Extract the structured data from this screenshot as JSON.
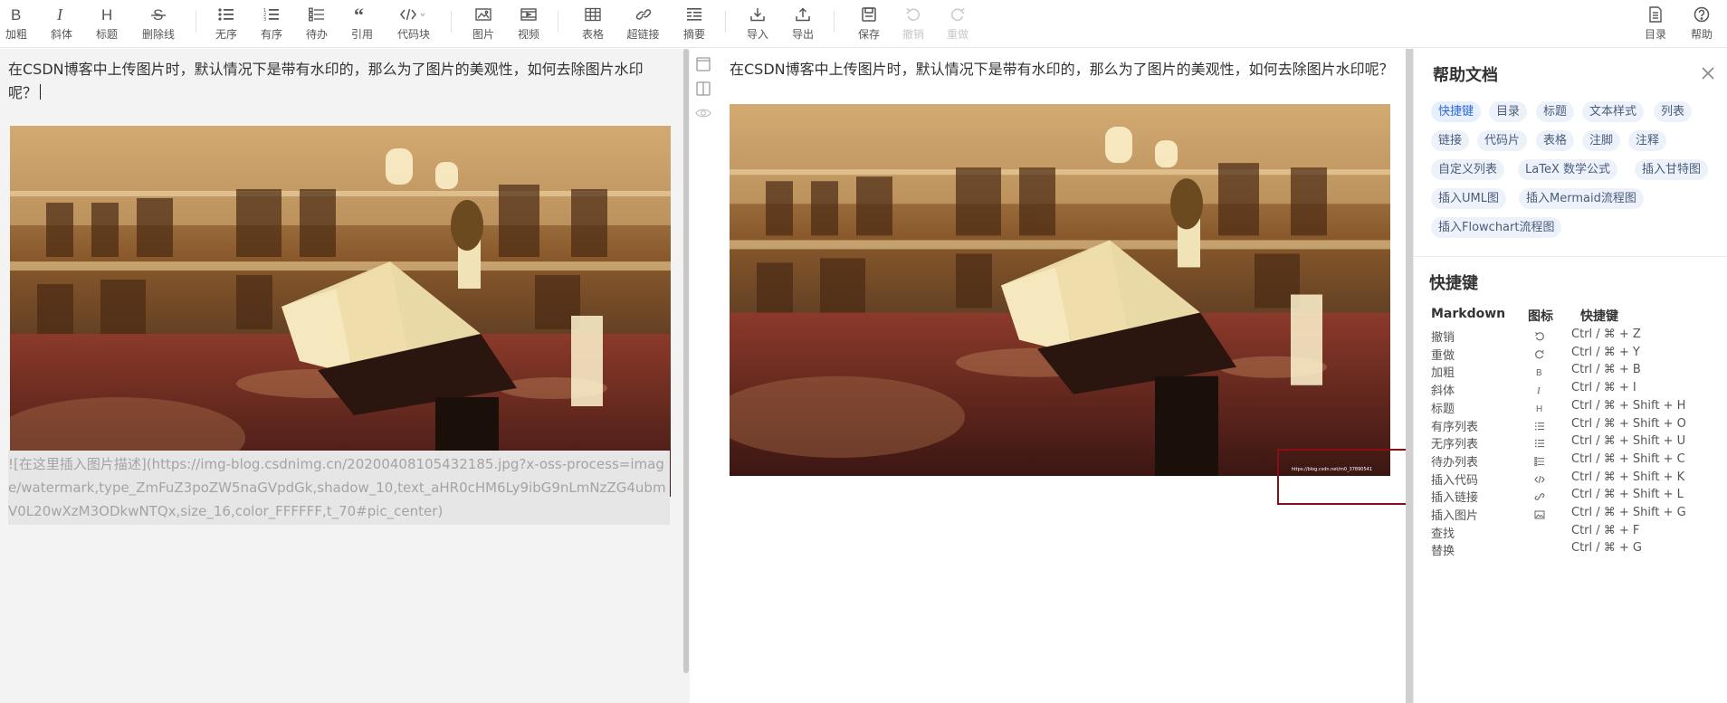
{
  "toolbar": {
    "items": [
      {
        "label": "加粗",
        "icon": "bold-icon",
        "disabled": false
      },
      {
        "label": "斜体",
        "icon": "italic-icon",
        "disabled": false
      },
      {
        "label": "标题",
        "icon": "heading-icon",
        "disabled": false
      },
      {
        "label": "删除线",
        "icon": "strikethrough-icon",
        "disabled": false
      },
      {
        "label": "无序",
        "icon": "unordered-list-icon",
        "disabled": false
      },
      {
        "label": "有序",
        "icon": "ordered-list-icon",
        "disabled": false
      },
      {
        "label": "待办",
        "icon": "todo-list-icon",
        "disabled": false
      },
      {
        "label": "引用",
        "icon": "quote-icon",
        "disabled": false
      },
      {
        "label": "代码块",
        "icon": "code-block-icon",
        "disabled": false
      },
      {
        "label": "图片",
        "icon": "image-icon",
        "disabled": false
      },
      {
        "label": "视频",
        "icon": "video-icon",
        "disabled": false
      },
      {
        "label": "表格",
        "icon": "table-icon",
        "disabled": false
      },
      {
        "label": "超链接",
        "icon": "link-icon",
        "disabled": false
      },
      {
        "label": "摘要",
        "icon": "summary-icon",
        "disabled": false
      },
      {
        "label": "导入",
        "icon": "import-icon",
        "disabled": false
      },
      {
        "label": "导出",
        "icon": "export-icon",
        "disabled": false
      },
      {
        "label": "保存",
        "icon": "save-icon",
        "disabled": false
      },
      {
        "label": "撤销",
        "icon": "undo-icon",
        "disabled": true
      },
      {
        "label": "重做",
        "icon": "redo-icon",
        "disabled": true
      }
    ],
    "right": [
      {
        "label": "目录",
        "icon": "toc-icon"
      },
      {
        "label": "帮助",
        "icon": "help-icon"
      }
    ]
  },
  "editor": {
    "text": "在CSDN博客中上传图片时，默认情况下是带有水印的，那么为了图片的美观性，如何去除图片水印呢？",
    "markdown": "![在这里插入图片描述](https://img-blog.csdnimg.cn/20200408105432185.jpg?x-oss-process=image/watermark,type_ZmFuZ3poZW5naGVpdGk,shadow_10,text_aHR0cHM6Ly9ibG9nLmNzZG4ubmV0L20wXzM3ODkwNTQx,size_16,color_FFFFFF,t_70#pic_center)"
  },
  "preview": {
    "text": "在CSDN博客中上传图片时，默认情况下是带有水印的，那么为了图片的美观性，如何去除图片水印呢？",
    "image_alt": "在这里插入图片描述",
    "watermark_text": "https://blog.csdn.net/m0_37890541"
  },
  "side_icons": [
    "single-column-icon",
    "two-column-icon",
    "eye-icon"
  ],
  "help": {
    "title": "帮助文档",
    "tags": [
      "快捷键",
      "目录",
      "标题",
      "文本样式",
      "列表",
      "链接",
      "代码片",
      "表格",
      "注脚",
      "注释",
      "自定义列表",
      "LaTeX 数学公式",
      "插入甘特图",
      "插入UML图",
      "插入Mermaid流程图",
      "插入Flowchart流程图"
    ],
    "active_tag": "快捷键",
    "shortcuts_title": "快捷键",
    "columns": [
      "Markdown",
      "图标",
      "快捷键"
    ],
    "rows": [
      {
        "name": "撤销",
        "icon": "undo-icon",
        "keys": "Ctrl / ⌘ + Z"
      },
      {
        "name": "重做",
        "icon": "redo-icon",
        "keys": "Ctrl / ⌘ + Y"
      },
      {
        "name": "加粗",
        "icon": "bold-icon",
        "keys": "Ctrl / ⌘ + B"
      },
      {
        "name": "斜体",
        "icon": "italic-icon",
        "keys": "Ctrl / ⌘ + I"
      },
      {
        "name": "标题",
        "icon": "heading-icon",
        "keys": "Ctrl / ⌘ + Shift + H"
      },
      {
        "name": "有序列表",
        "icon": "ordered-list-icon",
        "keys": "Ctrl / ⌘ + Shift + O"
      },
      {
        "name": "无序列表",
        "icon": "unordered-list-icon",
        "keys": "Ctrl / ⌘ + Shift + U"
      },
      {
        "name": "待办列表",
        "icon": "todo-list-icon",
        "keys": "Ctrl / ⌘ + Shift + C"
      },
      {
        "name": "插入代码",
        "icon": "code-icon",
        "keys": "Ctrl / ⌘ + Shift + K"
      },
      {
        "name": "插入链接",
        "icon": "link-icon",
        "keys": "Ctrl / ⌘ + Shift + L"
      },
      {
        "name": "插入图片",
        "icon": "image-icon",
        "keys": "Ctrl / ⌘ + Shift + G"
      },
      {
        "name": "查找",
        "icon": "",
        "keys": "Ctrl / ⌘ + F"
      },
      {
        "name": "替换",
        "icon": "",
        "keys": "Ctrl / ⌘ + G"
      }
    ]
  },
  "colors": {
    "highlight_box": "#8a0f12",
    "active_tag": "#2e6ad6",
    "tag_bg": "#edf2fa",
    "editor_bg": "#f3f3f3"
  }
}
